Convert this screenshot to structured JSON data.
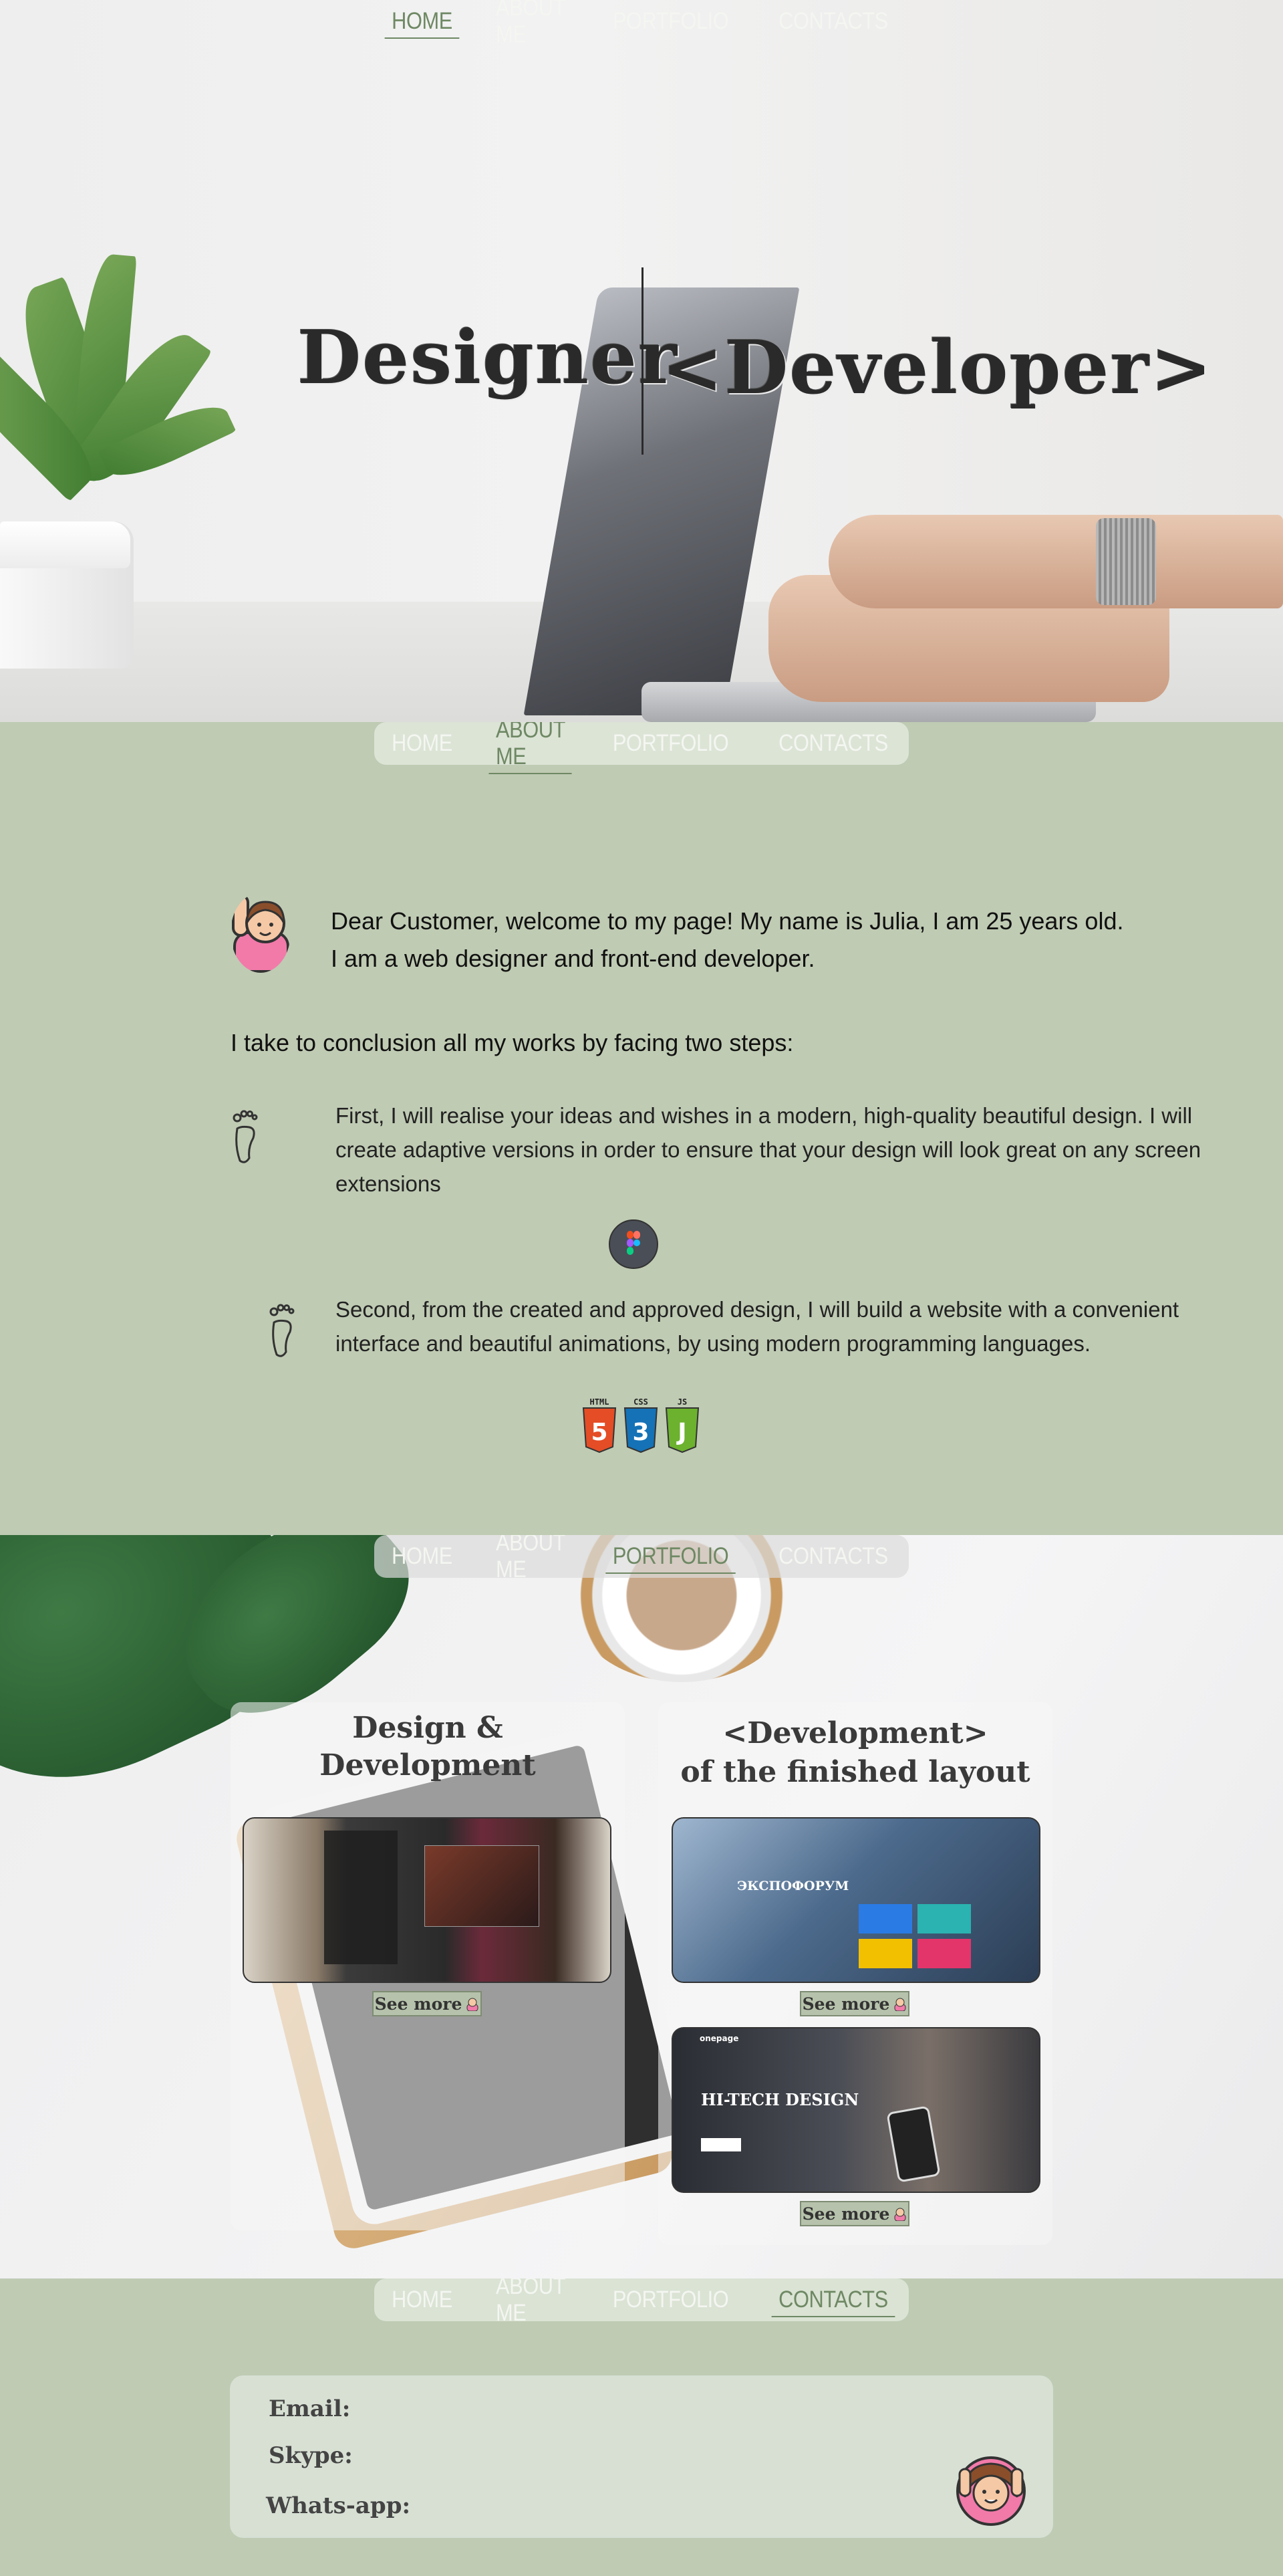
{
  "nav": {
    "items": [
      "HOME",
      "ABOUT ME",
      "PORTFOLIO",
      "CONTACTS"
    ]
  },
  "hero": {
    "left_title": "Designer",
    "right_title": "<Developer>"
  },
  "about": {
    "greeting_line1": "Dear Customer, welcome to my page! My name is Julia, I am 25 years old.",
    "greeting_line2": "I am a web designer and front-end developer.",
    "steps_heading": "I take to conclusion all my works by facing two steps:",
    "step1_line1": "First, I will realise your ideas and wishes in a modern, high-quality beautiful design. I will",
    "step1_line2": "create adaptive versions in order to ensure that your design will look great on any screen",
    "step1_line3": "extensions",
    "step2_line1": "Second,  from the created and approved design, I will build a website with a convenient",
    "step2_line2": "interface and beautiful animations, by using modern programming languages.",
    "tech_labels": [
      "HTML",
      "CSS",
      "JS"
    ]
  },
  "portfolio": {
    "card1_title_line1": "Design &",
    "card1_title_line2": "Development",
    "card2_title_line1": "<Development>",
    "card2_title_line2": "of the finished layout",
    "see_more": "See more",
    "shot2_brand": "ЭКСПОФОРУМ",
    "shot3_brand": "onepage",
    "shot3_heading": "HI-TECH DESIGN"
  },
  "contacts": {
    "email_label": "Email:",
    "skype_label": "Skype:",
    "whatsapp_label": "Whats-app:"
  },
  "colors": {
    "sage": "#bfcbb3",
    "nav_active": "#6e8863",
    "pink": "#f17aa9"
  }
}
